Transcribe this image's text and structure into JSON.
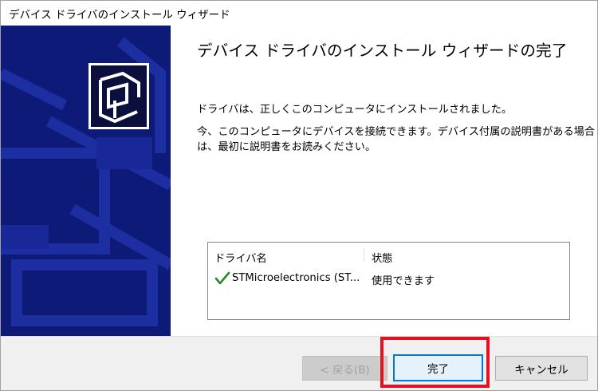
{
  "window": {
    "title": "デバイス ドライバのインストール ウィザード"
  },
  "content": {
    "heading": "デバイス ドライバのインストール ウィザードの完了",
    "message_installed": "ドライバは、正しくこのコンピュータにインストールされました。",
    "message_connect": "今、このコンピュータにデバイスを接続できます。デバイス付属の説明書がある場合は、最初に説明書をお読みください。"
  },
  "driver_list": {
    "columns": [
      "ドライバ名",
      "状態"
    ],
    "rows": [
      {
        "name": "STMicroelectronics (ST...",
        "status": "使用できます",
        "icon": "check-icon"
      }
    ]
  },
  "buttons": {
    "back_label": "< 戻る(B)",
    "finish_label": "完了",
    "cancel_label": "キャンセル"
  },
  "colors": {
    "sidebar_bg": "#0d1a78",
    "check_green": "#2a8a2a",
    "highlight_red": "#e8101e",
    "focus_blue": "#0078d7"
  }
}
